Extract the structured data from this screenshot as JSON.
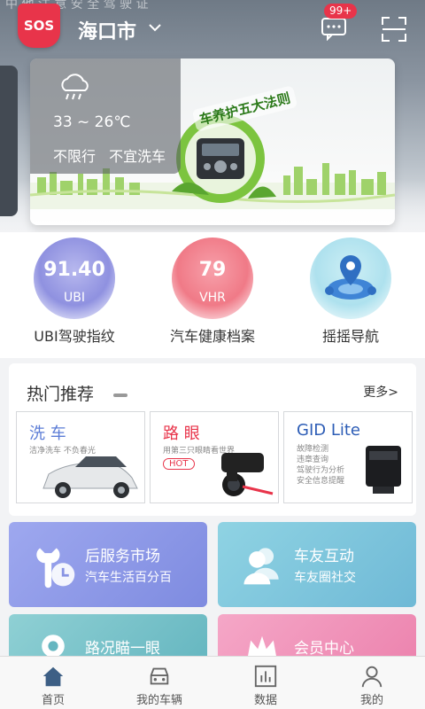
{
  "status_partial_text": "中  他  注  意  安  全  驾  驶  证",
  "header": {
    "sos_label": "SOS",
    "city": "海口市",
    "message_badge": "99+"
  },
  "banner": {
    "temperature": "33 ~ 26℃",
    "limit_text": "不限行",
    "advice_text": "不宜洗车",
    "promo_title": "车养护五大法则"
  },
  "quick_entries": [
    {
      "value": "91.40",
      "sub": "UBI",
      "label": "UBI驾驶指纹"
    },
    {
      "value": "79",
      "sub": "VHR",
      "label": "汽车健康档案"
    },
    {
      "label": "摇摇导航"
    }
  ],
  "hot": {
    "title": "热门推荐",
    "more": "更多>",
    "items": [
      {
        "title": "洗 车",
        "desc": "洁净洗车  不负春光",
        "color": "#5b7cd6"
      },
      {
        "title": "路 眼",
        "desc": "用第三只眼睛看世界",
        "tag": "HOT",
        "color": "#e8344a"
      },
      {
        "title": "GID Lite",
        "lines": [
          "故障检测",
          "违章查询",
          "驾驶行为分析",
          "安全信息提醒"
        ],
        "color": "#2d5db6"
      }
    ]
  },
  "services": [
    {
      "title": "后服务市场",
      "subtitle": "汽车生活百分百"
    },
    {
      "title": "车友互动",
      "subtitle": "车友圈社交"
    },
    {
      "title": "路况瞄一眼"
    },
    {
      "title": "会员中心"
    }
  ],
  "tabs": [
    {
      "label": "首页",
      "icon": "home-icon",
      "active": true
    },
    {
      "label": "我的车辆",
      "icon": "car-icon"
    },
    {
      "label": "数据",
      "icon": "chart-icon"
    },
    {
      "label": "我的",
      "icon": "user-icon"
    }
  ]
}
